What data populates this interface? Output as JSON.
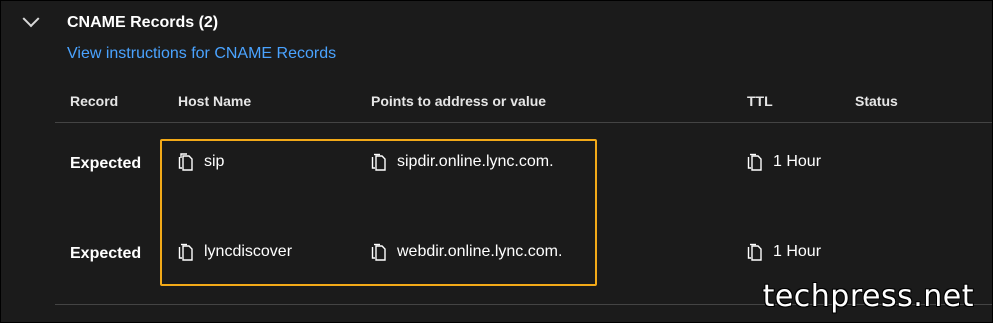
{
  "section": {
    "title": "CNAME Records (2)",
    "instructions_link": "View instructions for CNAME Records"
  },
  "columns": [
    "Record",
    "Host Name",
    "Points to address or value",
    "TTL",
    "Status"
  ],
  "rows": [
    {
      "record": "Expected",
      "host": "sip",
      "points_to": "sipdir.online.lync.com.",
      "ttl": "1 Hour",
      "status": ""
    },
    {
      "record": "Expected",
      "host": "lyncdiscover",
      "points_to": "webdir.online.lync.com.",
      "ttl": "1 Hour",
      "status": ""
    }
  ],
  "watermark": "techpress.net",
  "colors": {
    "link": "#4aa3ff",
    "highlight": "#f2a918",
    "background": "#1b1b1b"
  },
  "icons": {
    "copy": "copy-icon",
    "expand": "chevron-down-icon"
  }
}
